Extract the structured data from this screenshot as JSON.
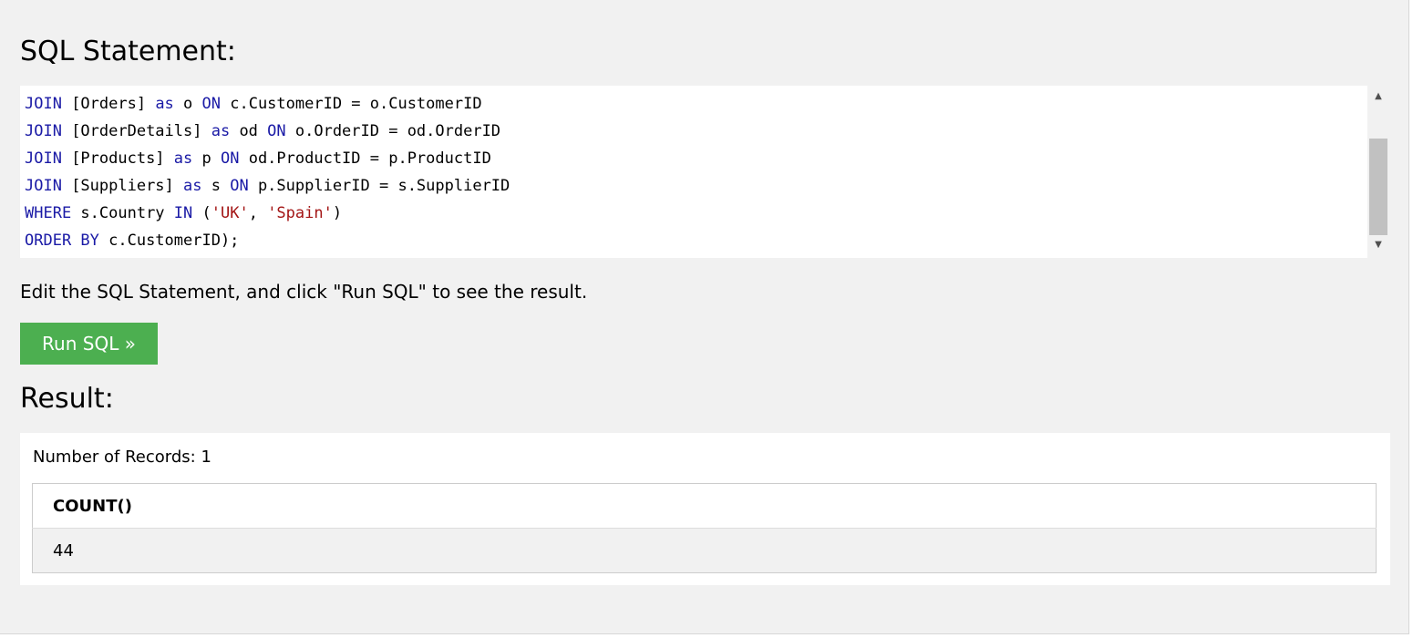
{
  "headings": {
    "sql_statement": "SQL Statement:",
    "result": "Result:"
  },
  "editor": {
    "lines": [
      {
        "kw1": "JOIN",
        "t1": " [Orders] ",
        "kw2": "as",
        "t2": " o ",
        "kw3": "ON",
        "t3": " c.CustomerID = o.CustomerID"
      },
      {
        "kw1": "JOIN",
        "t1": " [OrderDetails] ",
        "kw2": "as",
        "t2": " od ",
        "kw3": "ON",
        "t3": " o.OrderID = od.OrderID"
      },
      {
        "kw1": "JOIN",
        "t1": " [Products] ",
        "kw2": "as",
        "t2": " p ",
        "kw3": "ON",
        "t3": " od.ProductID = p.ProductID"
      },
      {
        "kw1": "JOIN",
        "t1": " [Suppliers] ",
        "kw2": "as",
        "t2": " s ",
        "kw3": "ON",
        "t3": " p.SupplierID = s.SupplierID"
      },
      {
        "kw1": "WHERE",
        "t1": " s.Country ",
        "kw2": "IN",
        "t2": " (",
        "s1": "'UK'",
        "t3": ", ",
        "s2": "'Spain'",
        "t4": ")"
      },
      {
        "kw1": "ORDER BY",
        "t1": " c.CustomerID);"
      }
    ]
  },
  "scrollbar": {
    "up_icon": "triangle-up-icon",
    "down_icon": "triangle-down-icon"
  },
  "instruction": "Edit the SQL Statement, and click \"Run SQL\" to see the result.",
  "run_button": {
    "label": "Run SQL »",
    "color": "#4caf50"
  },
  "result": {
    "record_count": "Number of Records: 1",
    "columns": [
      "COUNT()"
    ],
    "rows": [
      [
        "44"
      ]
    ]
  }
}
